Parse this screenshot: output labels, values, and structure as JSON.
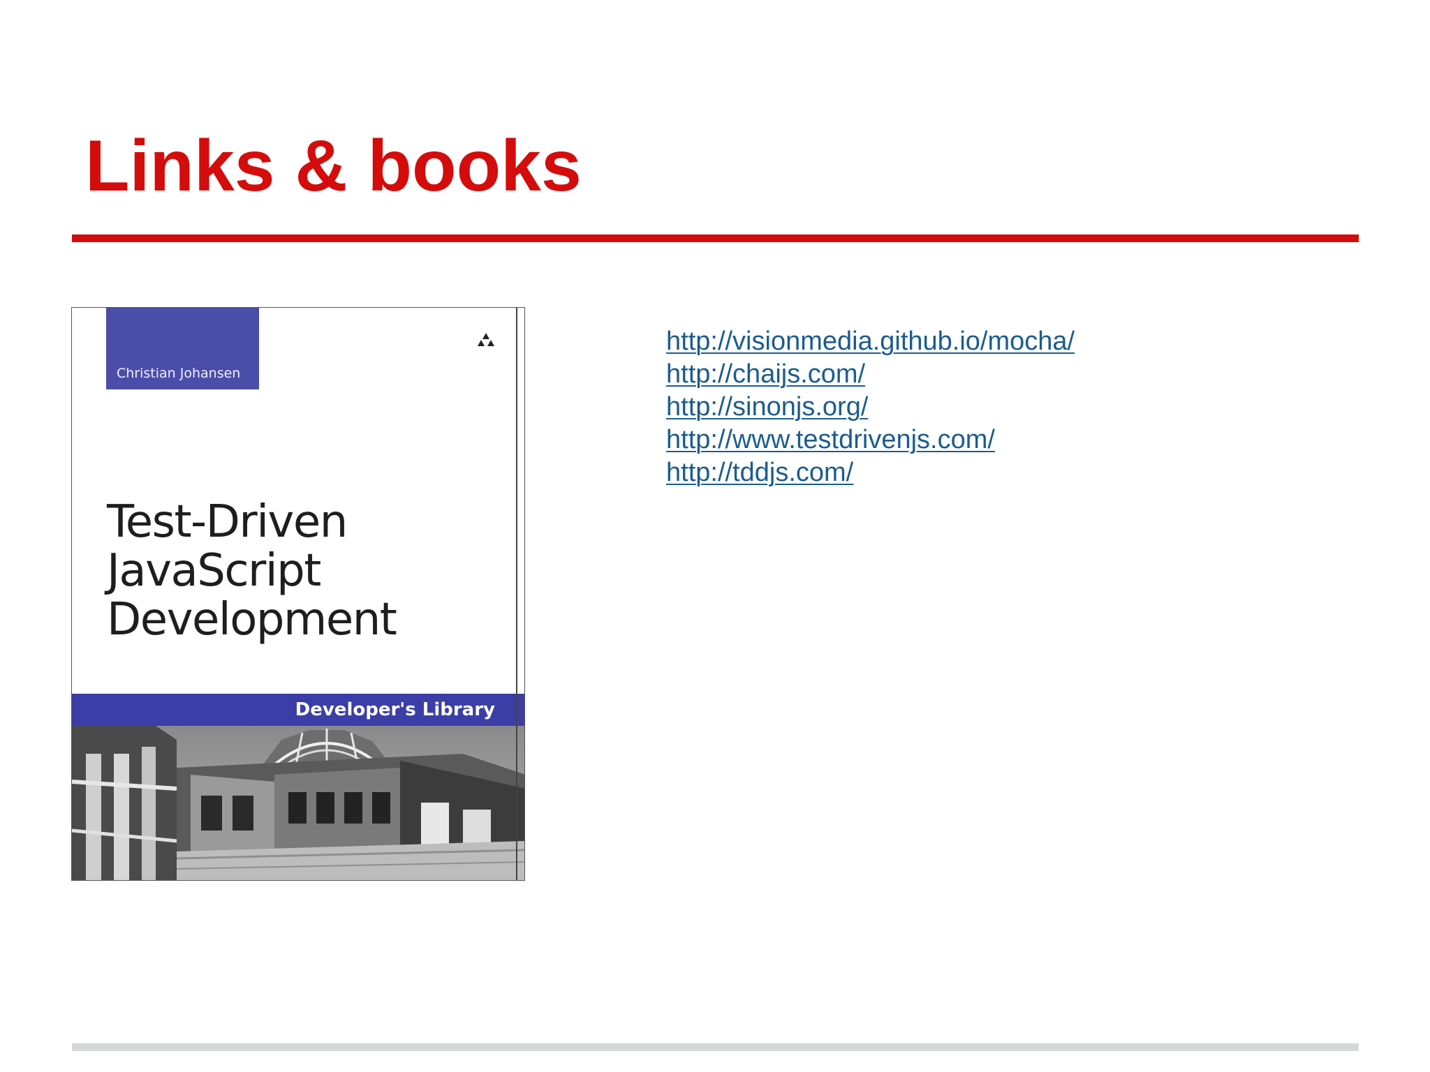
{
  "slide": {
    "title": "Links & books",
    "accent_color": "#d40c0c",
    "footer_rule_color": "#d6d7d8"
  },
  "book": {
    "author": "Christian Johansen",
    "title_lines": [
      "Test-Driven",
      "JavaScript",
      "Development"
    ],
    "series": "Developer's Library",
    "publisher_logo_icon": "publisher-logo-icon",
    "band_color": "#3b3ea6",
    "author_box_color": "#4b4ea8"
  },
  "links": [
    "http://visionmedia.github.io/mocha/",
    "http://chaijs.com/",
    "http://sinonjs.org/",
    "http://www.testdrivenjs.com/",
    "http://tddjs.com/"
  ],
  "link_color": "#1b5c8f"
}
